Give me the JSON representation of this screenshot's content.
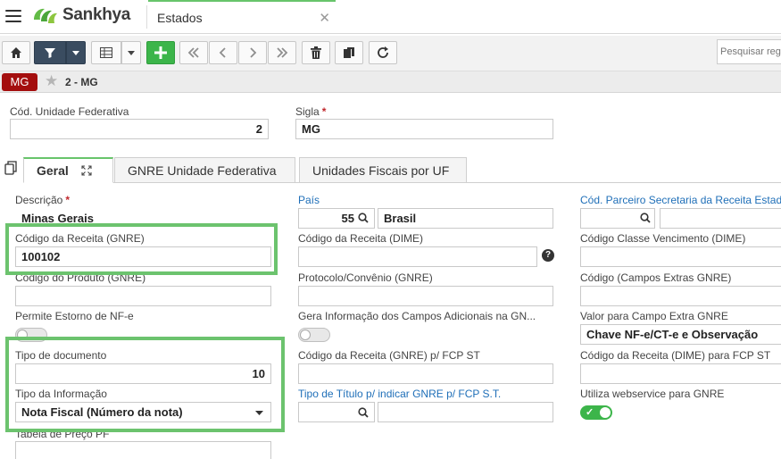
{
  "app": {
    "brand": "Sankhya",
    "tab_title": "Estados"
  },
  "toolbar": {
    "search_placeholder": "Pesquisar registros"
  },
  "record": {
    "badge": "MG",
    "title": "2 - MG"
  },
  "header_fields": {
    "cod_uf": {
      "label": "Cód. Unidade Federativa",
      "value": "2"
    },
    "sigla": {
      "label": "Sigla",
      "value": "MG"
    }
  },
  "tabs": [
    {
      "label": "Geral"
    },
    {
      "label": "GNRE Unidade Federativa"
    },
    {
      "label": "Unidades Fiscais por UF"
    }
  ],
  "fields": {
    "descricao": {
      "label": "Descrição",
      "value": "Minas Gerais"
    },
    "cod_receita_gnre": {
      "label": "Código da Receita (GNRE)",
      "value": "100102"
    },
    "cod_produto_gnre": {
      "label": "Código do Produto (GNRE)",
      "value": ""
    },
    "permite_estorno": {
      "label": "Permite Estorno de NF-e"
    },
    "tipo_documento": {
      "label": "Tipo de documento",
      "value": "10"
    },
    "tipo_informacao": {
      "label": "Tipo da Informação",
      "value": "Nota Fiscal (Número da nota)"
    },
    "tabela_preco": {
      "label": "Tabela de Preço PF"
    },
    "pais": {
      "label": "País",
      "code": "55",
      "name": "Brasil"
    },
    "cod_receita_dime": {
      "label": "Código da Receita (DIME)",
      "value": ""
    },
    "protocolo": {
      "label": "Protocolo/Convênio (GNRE)",
      "value": ""
    },
    "gera_info": {
      "label": "Gera Informação dos Campos Adicionais na GN..."
    },
    "cod_receita_fcp": {
      "label": "Código da Receita (GNRE) p/ FCP ST",
      "value": ""
    },
    "tipo_titulo": {
      "label": "Tipo de Título p/ indicar GNRE p/ FCP S.T.",
      "value": ""
    },
    "cod_parceiro": {
      "label": "Cód. Parceiro Secretaria da Receita Estadual"
    },
    "cod_classe_venc": {
      "label": "Código Classe Vencimento (DIME)"
    },
    "cod_campos_extras": {
      "label": "Código (Campos Extras GNRE)"
    },
    "valor_campo_extra": {
      "label": "Valor para Campo Extra GNRE",
      "value": "Chave NF-e/CT-e e Observação"
    },
    "cod_receita_dime_fcp": {
      "label": "Código da Receita (DIME) para FCP ST"
    },
    "utiliza_ws": {
      "label": "Utiliza webservice para GNRE"
    }
  },
  "colors": {
    "brand_green": "#3cb54a",
    "badge_red": "#a40e0e",
    "link_blue": "#1f6fb8",
    "highlight": "#6cc36e"
  },
  "icons": [
    "menu-icon",
    "home-icon",
    "filter-icon",
    "grid-icon",
    "plus-icon",
    "first-page-icon",
    "prev-icon",
    "next-icon",
    "last-page-icon",
    "trash-icon",
    "copy-icon",
    "refresh-icon",
    "star-icon",
    "search-icon",
    "help-icon",
    "expand-icon",
    "chevron-down-icon"
  ]
}
